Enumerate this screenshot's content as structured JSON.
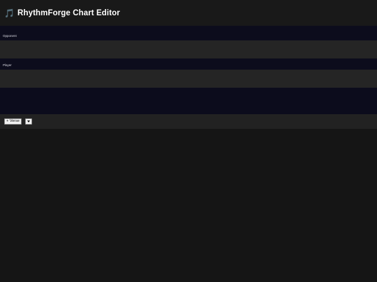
{
  "app": {
    "icon": "music-note-icon",
    "icon_glyph": "🎵",
    "title": "RhythmForge Chart Editor"
  },
  "lanes": {
    "opponent": {
      "label": "Opponent"
    },
    "player": {
      "label": "Player"
    }
  },
  "toolbar": {
    "add_section_label": "+ Verse",
    "section_dropdown_icon": "chevron-down-icon"
  },
  "colors": {
    "page_background": "#151515",
    "header_background": "#191919",
    "editor_background": "#0c0c1c",
    "lane_track": "#252525",
    "toolbar_background": "#222222"
  }
}
